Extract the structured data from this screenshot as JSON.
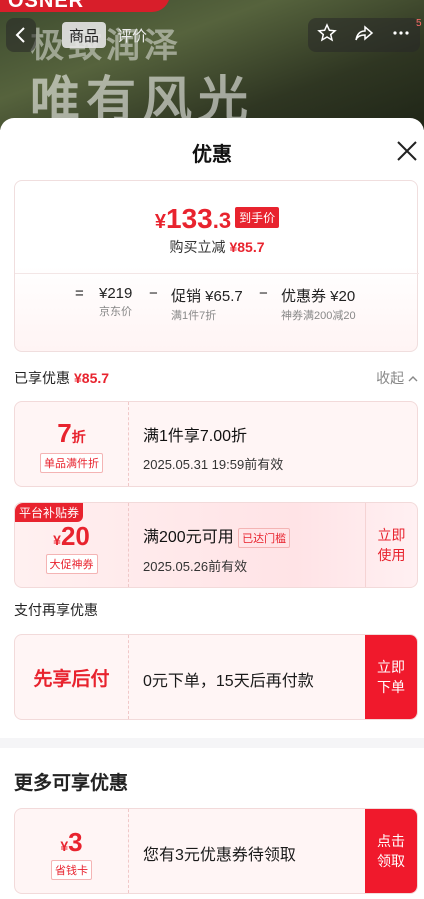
{
  "header": {
    "tab_goods": "商品",
    "tab_eval": "评价",
    "badge": "5",
    "banner_text_1": "极致润泽",
    "banner_text_2": "唯有风光"
  },
  "sheet": {
    "title": "优惠"
  },
  "price_card": {
    "yen": "¥",
    "price_int": "133",
    "price_dec": ".3",
    "tag": "到手价",
    "sub_label": "购买立减",
    "sub_amount": "¥85.7",
    "eq": "=",
    "item1_value": "¥219",
    "item1_sub": "京东价",
    "op1": "−",
    "item2_value": "促销 ¥65.7",
    "item2_sub": "满1件7折",
    "op2": "−",
    "item3_value": "优惠券 ¥20",
    "item3_sub": "神券满200减20"
  },
  "enjoyed": {
    "label": "已享优惠",
    "amount": "¥85.7",
    "collapse": "收起"
  },
  "coupon1": {
    "value": "7",
    "unit": "折",
    "tag": "单品满件折",
    "title": "满1件享7.00折",
    "expire": "2025.05.31 19:59前有效"
  },
  "coupon2": {
    "corner": "平台补贴券",
    "yen": "¥",
    "value": "20",
    "tag": "大促神券",
    "title": "满200元可用",
    "status": "已达门槛",
    "expire": "2025.05.26前有效",
    "action": "立即使用"
  },
  "pay_section": {
    "label": "支付再享优惠",
    "name": "先享后付",
    "desc": "0元下单，15天后再付款",
    "action": "立即下单"
  },
  "more": {
    "title": "更多可享优惠",
    "yen": "¥",
    "value": "3",
    "tag": "省钱卡",
    "desc": "您有3元优惠券待领取",
    "action": "点击领取"
  },
  "colors": {
    "accent": "#e8232e",
    "button": "#f0192c"
  }
}
